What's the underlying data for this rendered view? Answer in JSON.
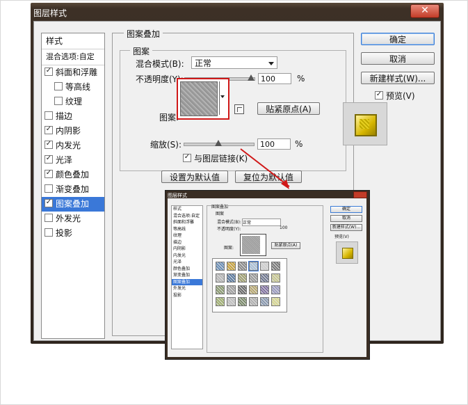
{
  "window": {
    "title": "图层样式",
    "close_glyph": "✕"
  },
  "style_list": {
    "header": "样式",
    "blend_options": "混合选项:自定",
    "items": [
      {
        "label": "斜面和浮雕",
        "checked": true,
        "sub": false
      },
      {
        "label": "等高线",
        "checked": false,
        "sub": true
      },
      {
        "label": "纹理",
        "checked": false,
        "sub": true
      },
      {
        "label": "描边",
        "checked": false,
        "sub": false
      },
      {
        "label": "内阴影",
        "checked": true,
        "sub": false
      },
      {
        "label": "内发光",
        "checked": true,
        "sub": false
      },
      {
        "label": "光泽",
        "checked": true,
        "sub": false
      },
      {
        "label": "颜色叠加",
        "checked": true,
        "sub": false
      },
      {
        "label": "渐变叠加",
        "checked": false,
        "sub": false
      },
      {
        "label": "图案叠加",
        "checked": true,
        "sub": false,
        "selected": true
      },
      {
        "label": "外发光",
        "checked": false,
        "sub": false
      },
      {
        "label": "投影",
        "checked": false,
        "sub": false
      }
    ]
  },
  "panel": {
    "group_title": "图案叠加",
    "sub_title": "图案",
    "blend_mode_label": "混合模式(B):",
    "blend_mode_value": "正常",
    "opacity_label": "不透明度(Y):",
    "opacity_value": "100",
    "opacity_unit": "%",
    "pattern_label": "图案:",
    "snap_origin_button": "贴紧原点(A)",
    "scale_label": "缩放(S):",
    "scale_value": "100",
    "scale_unit": "%",
    "link_label": "与图层链接(K)",
    "link_checked": true,
    "make_default_button": "设置为默认值",
    "reset_default_button": "复位为默认值"
  },
  "right": {
    "ok": "确定",
    "cancel": "取消",
    "new_style": "新建样式(W)...",
    "preview_label": "预览(V)",
    "preview_checked": true
  },
  "inset": {
    "title": "图层样式",
    "header": "样式",
    "blend_options": "混合选项:自定",
    "items": [
      "斜面和浮雕",
      "等高线",
      "纹理",
      "描边",
      "内阴影",
      "内发光",
      "光泽",
      "颜色叠加",
      "渐变叠加",
      "图案叠加",
      "外发光",
      "投影"
    ],
    "group_title": "图案叠加",
    "sub_title": "图案",
    "blend_mode_label": "混合模式(B):",
    "blend_mode_value": "正常",
    "opacity_label": "不透明度(Y):",
    "opacity_value": "100",
    "pattern_label": "图案:",
    "snap_origin_button": "贴紧原点(A)",
    "ok": "确定",
    "cancel": "取消",
    "new_style": "新建样式(W)...",
    "preview_label": "预览(V)",
    "tile_colors": [
      "#6a8fb8",
      "#c9a33c",
      "#8a8a8a",
      "#a8c0d8",
      "#cfcfcf",
      "#7a7a7a",
      "#b8b8b8",
      "#5a7aa0",
      "#a0a070",
      "#9a9a9a",
      "#707890",
      "#c8c890",
      "#8a9a70",
      "#a0a0a0",
      "#6a6a6a",
      "#b8a870",
      "#8070a0",
      "#9a9ac0",
      "#a0b070",
      "#c0c0c0",
      "#7a8a6a",
      "#b0b0b0",
      "#8898b0",
      "#d8d890"
    ]
  },
  "accent_red": "#d01818",
  "selection_blue": "#3a78d8"
}
